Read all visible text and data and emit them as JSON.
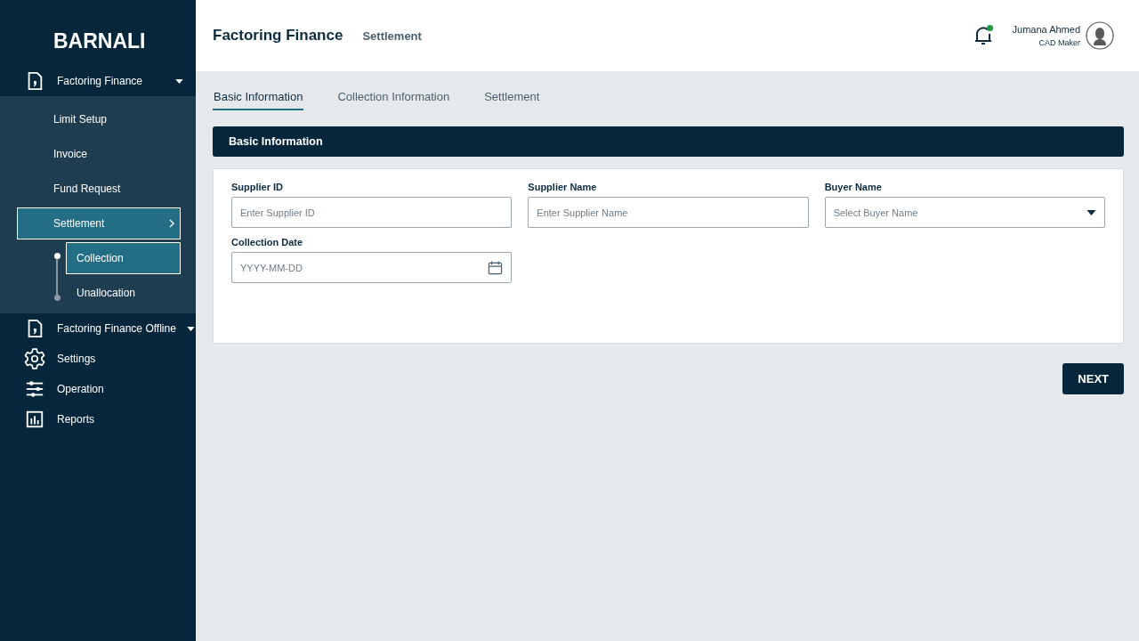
{
  "sidebar": {
    "brand": "BARNALI",
    "menu": [
      {
        "kind": "group",
        "label": "Factoring Finance",
        "expanded": true,
        "children": [
          {
            "label": "Limit Setup",
            "selected": false
          },
          {
            "label": "Invoice",
            "selected": false
          },
          {
            "label": "Fund Request",
            "selected": false
          },
          {
            "label": "Settlement",
            "selected": true,
            "children": [
              {
                "label": "Collection",
                "selected": true
              },
              {
                "label": "Unallocation",
                "selected": false
              }
            ]
          }
        ]
      },
      {
        "kind": "group",
        "label": "Factoring Finance Offline",
        "expanded": false
      },
      {
        "kind": "link",
        "label": "Settings"
      },
      {
        "kind": "link",
        "label": "Operation"
      },
      {
        "kind": "link",
        "label": "Reports"
      }
    ]
  },
  "header": {
    "title": "Factoring Finance",
    "breadcrumb": "Settlement",
    "notifications_unread": true,
    "user": {
      "name": "Jumana Ahmed",
      "role": "CAD Maker"
    }
  },
  "tabs": [
    {
      "label": "Basic Information",
      "selected": true
    },
    {
      "label": "Collection Information",
      "selected": false
    },
    {
      "label": "Settlement",
      "selected": false
    }
  ],
  "section": {
    "title": "Basic Information",
    "fields": [
      {
        "kind": "text",
        "label": "Supplier ID",
        "placeholder": "Enter Supplier ID"
      },
      {
        "kind": "text",
        "label": "Supplier Name",
        "placeholder": "Enter Supplier Name"
      },
      {
        "kind": "select",
        "label": "Buyer Name",
        "placeholder": "Select Buyer Name"
      },
      {
        "kind": "date",
        "label": "Collection Date",
        "placeholder": "YYYY-MM-DD"
      }
    ]
  },
  "buttons": [
    "NEXT"
  ]
}
